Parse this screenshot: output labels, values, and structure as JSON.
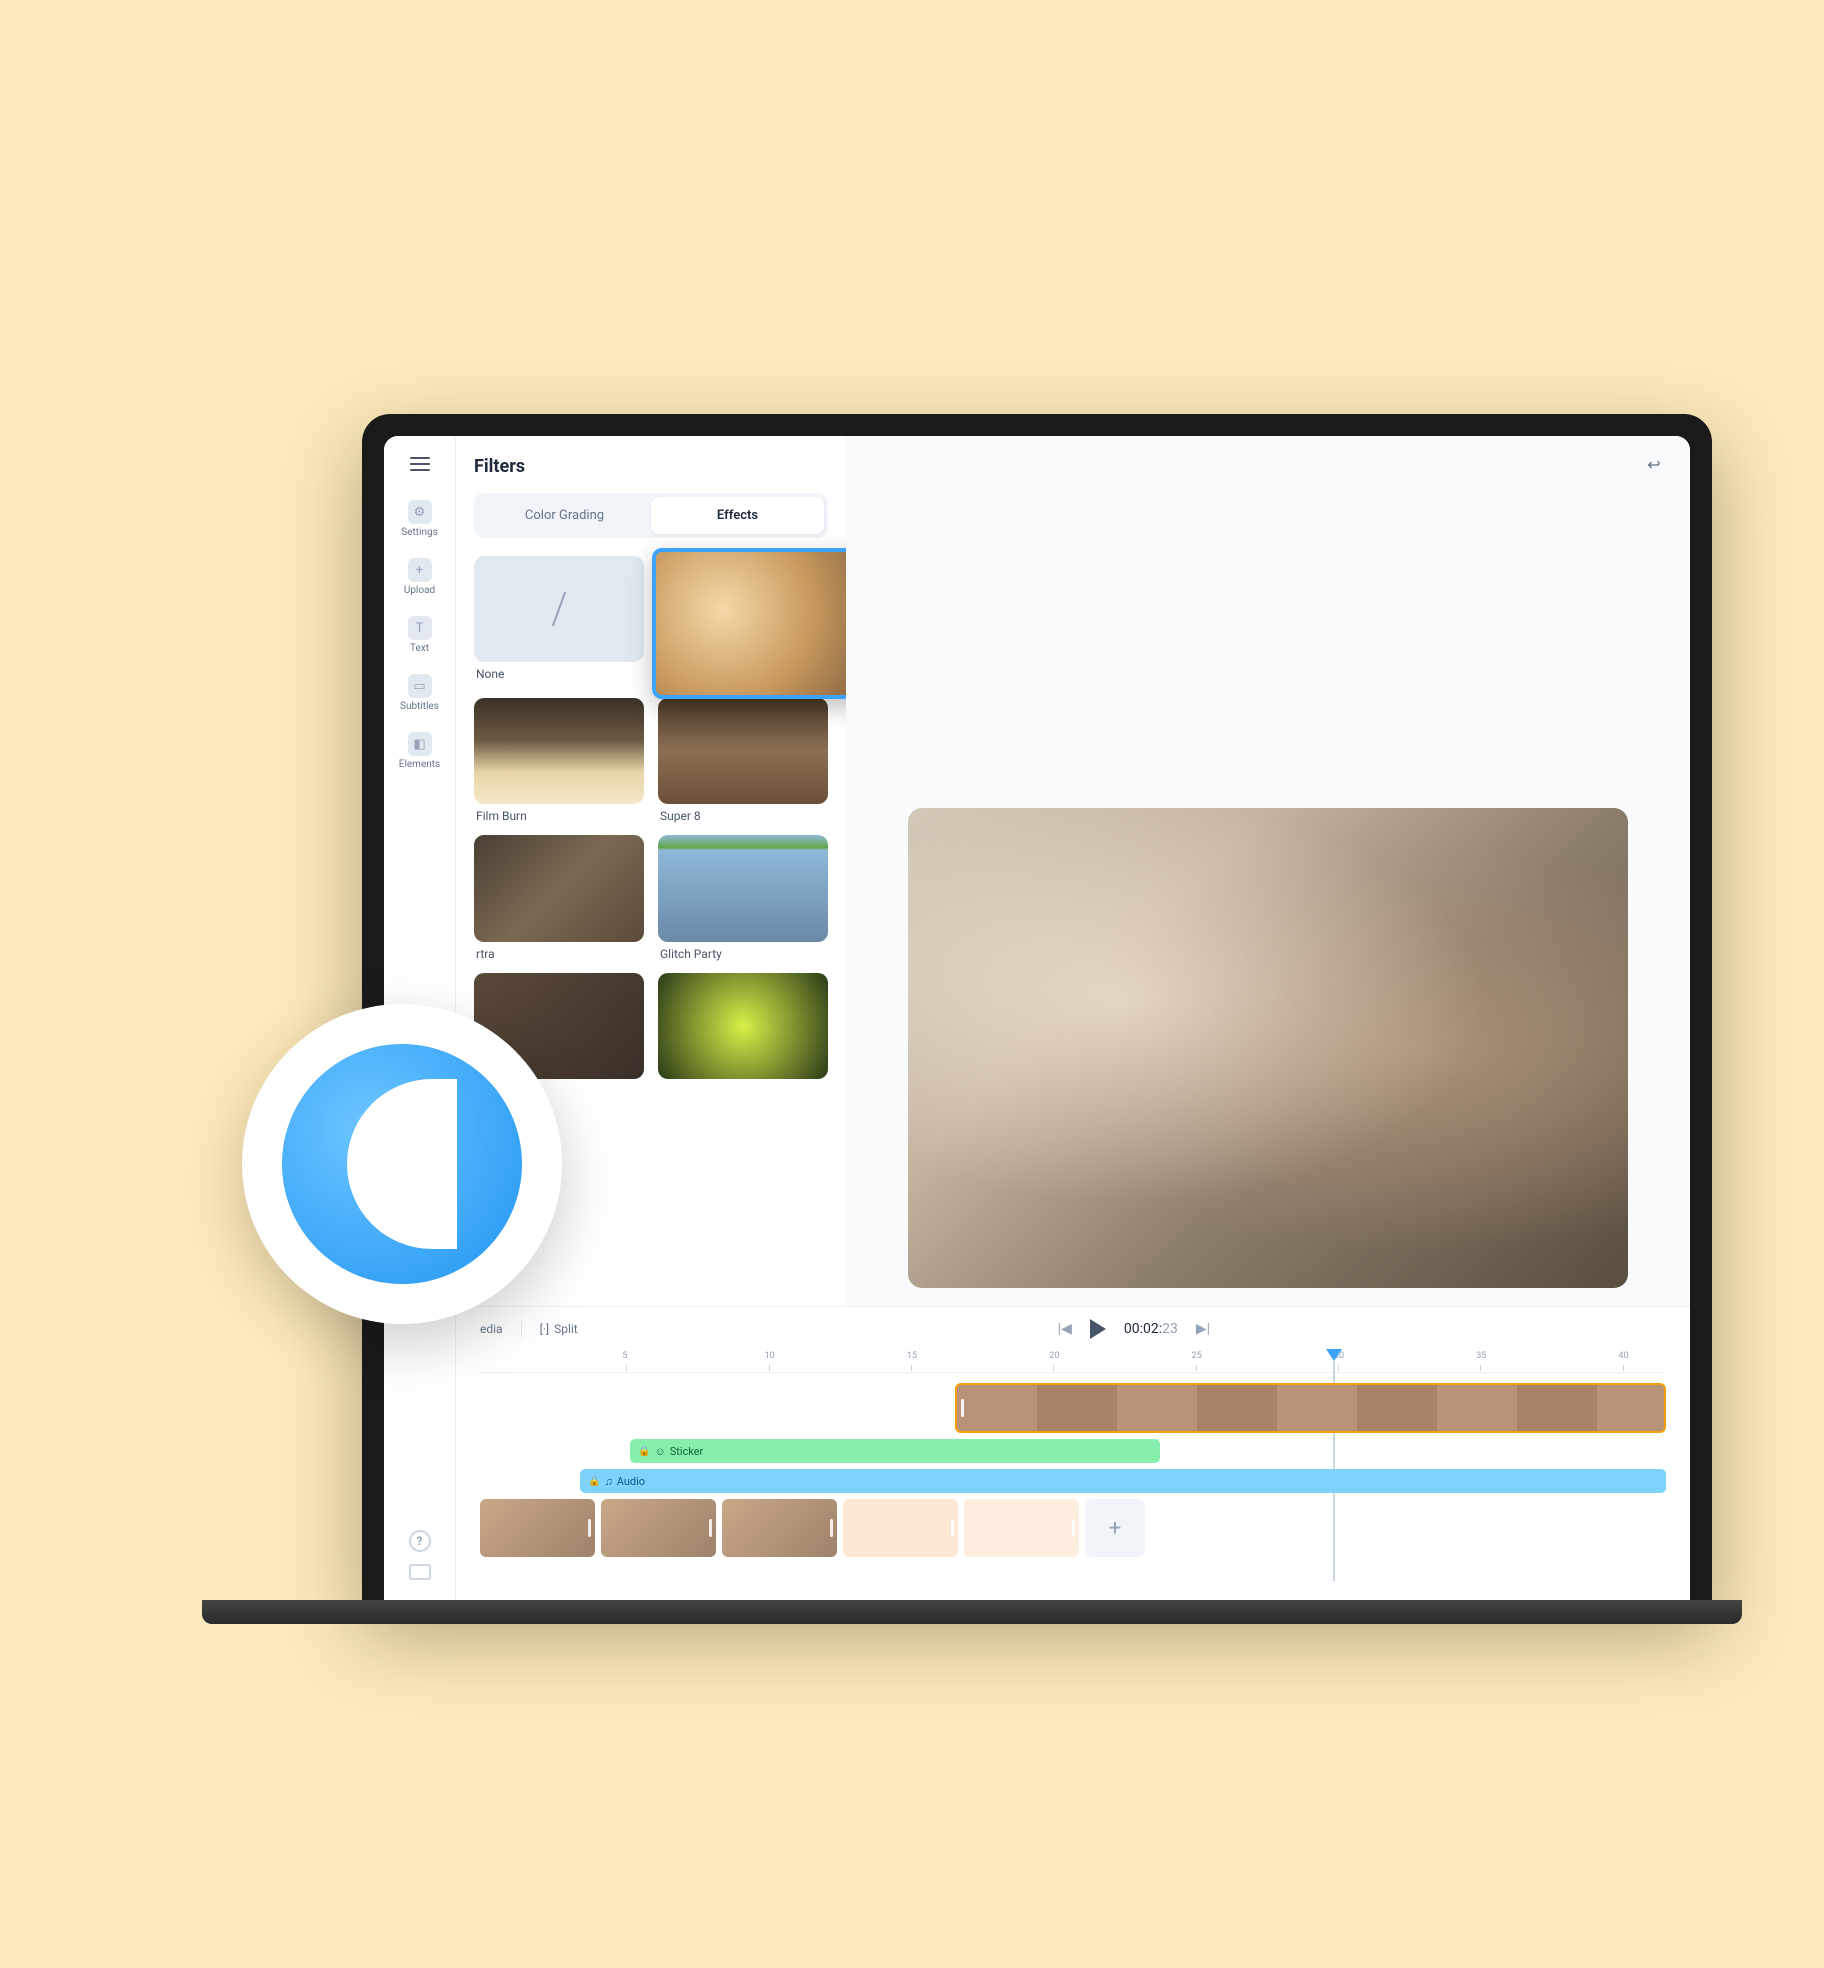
{
  "sidebar": {
    "items": [
      {
        "label": "Settings",
        "icon": "gear"
      },
      {
        "label": "Upload",
        "icon": "plus"
      },
      {
        "label": "Text",
        "icon": "text"
      },
      {
        "label": "Subtitles",
        "icon": "subtitles"
      },
      {
        "label": "Elements",
        "icon": "elements"
      }
    ]
  },
  "panel": {
    "title": "Filters",
    "tabs": {
      "color": "Color Grading",
      "effects": "Effects",
      "active": "effects"
    },
    "filters": {
      "none": "None",
      "film_burn": "Film Burn",
      "super8": "Super 8",
      "rtra": "rtra",
      "glitch_party": "Glitch Party"
    }
  },
  "toolbar": {
    "media": "edia",
    "split": "Split",
    "undo_icon": "↩"
  },
  "playback": {
    "timecode_dark": "00:02:",
    "timecode_light": "23"
  },
  "ruler": {
    "ticks": [
      "5",
      "10",
      "15",
      "20",
      "25",
      "30",
      "35",
      "40"
    ]
  },
  "tracks": {
    "sticker_label": "Sticker",
    "audio_label": "Audio",
    "add": "+"
  },
  "colors": {
    "accent": "#3ca4ff",
    "clip_border": "#f59e0b",
    "sticker": "#86efac",
    "audio": "#7dd3fc"
  }
}
